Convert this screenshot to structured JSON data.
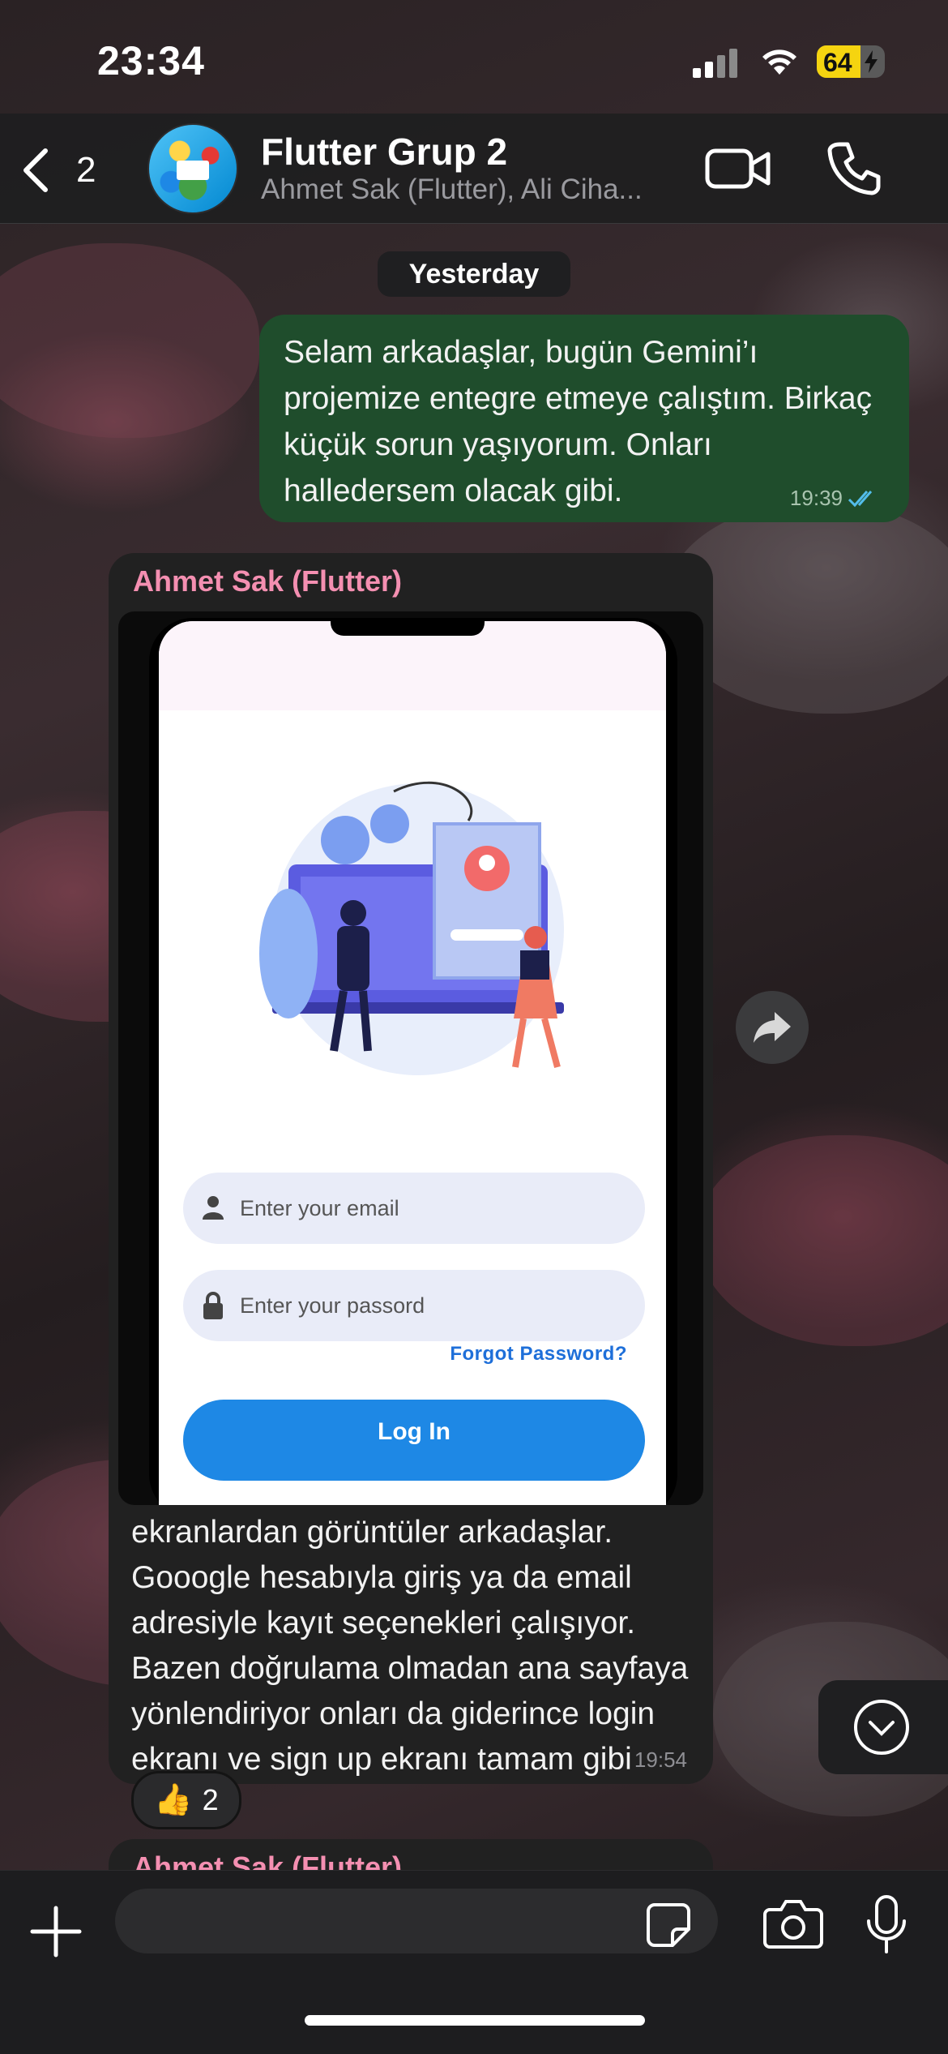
{
  "status_bar": {
    "time": "23:34",
    "battery": "64",
    "battery_level": 0.64
  },
  "header": {
    "back_count": "2",
    "group_name": "Flutter Grup 2",
    "members": "Ahmet Sak (Flutter), Ali Ciha..."
  },
  "chat": {
    "date_chip": "Yesterday",
    "outgoing": {
      "text": "Selam arkadaşlar, bugün Gemini’ı projemize entegre etmeye çalıştım. Birkaç küçük sorun yaşıyorum. Onları halledersem olacak gibi.",
      "time": "19:39"
    },
    "incoming": {
      "sender": "Ahmet Sak (Flutter)",
      "image": {
        "email_placeholder": "Enter your email",
        "password_placeholder": "Enter your passord",
        "forgot": "Forgot Password?",
        "login": "Log In"
      },
      "text": "ekranlardan görüntüler arkadaşlar. Gooogle hesabıyla giriş ya da email adresiyle kayıt seçenekleri çalışıyor. Bazen doğrulama olmadan ana sayfaya yönlendiriyor onları da giderince login ekranı ve sign up ekranı tamam gibi",
      "time": "19:54",
      "reaction": {
        "emoji": "👍",
        "count": "2"
      }
    },
    "next_sender": "Ahmet Sak (Flutter)"
  },
  "colors": {
    "outgoing_bubble": "#1f4d2c",
    "incoming_bubble": "#212121",
    "sender_name": "#f48fb1",
    "read_ticks": "#53bdeb",
    "login_button": "#1e88e5"
  },
  "icons": [
    "chevron-left-icon",
    "video-call-icon",
    "phone-icon",
    "forward-icon",
    "chevron-down-icon",
    "plus-icon",
    "sticker-icon",
    "camera-icon",
    "microphone-icon"
  ]
}
